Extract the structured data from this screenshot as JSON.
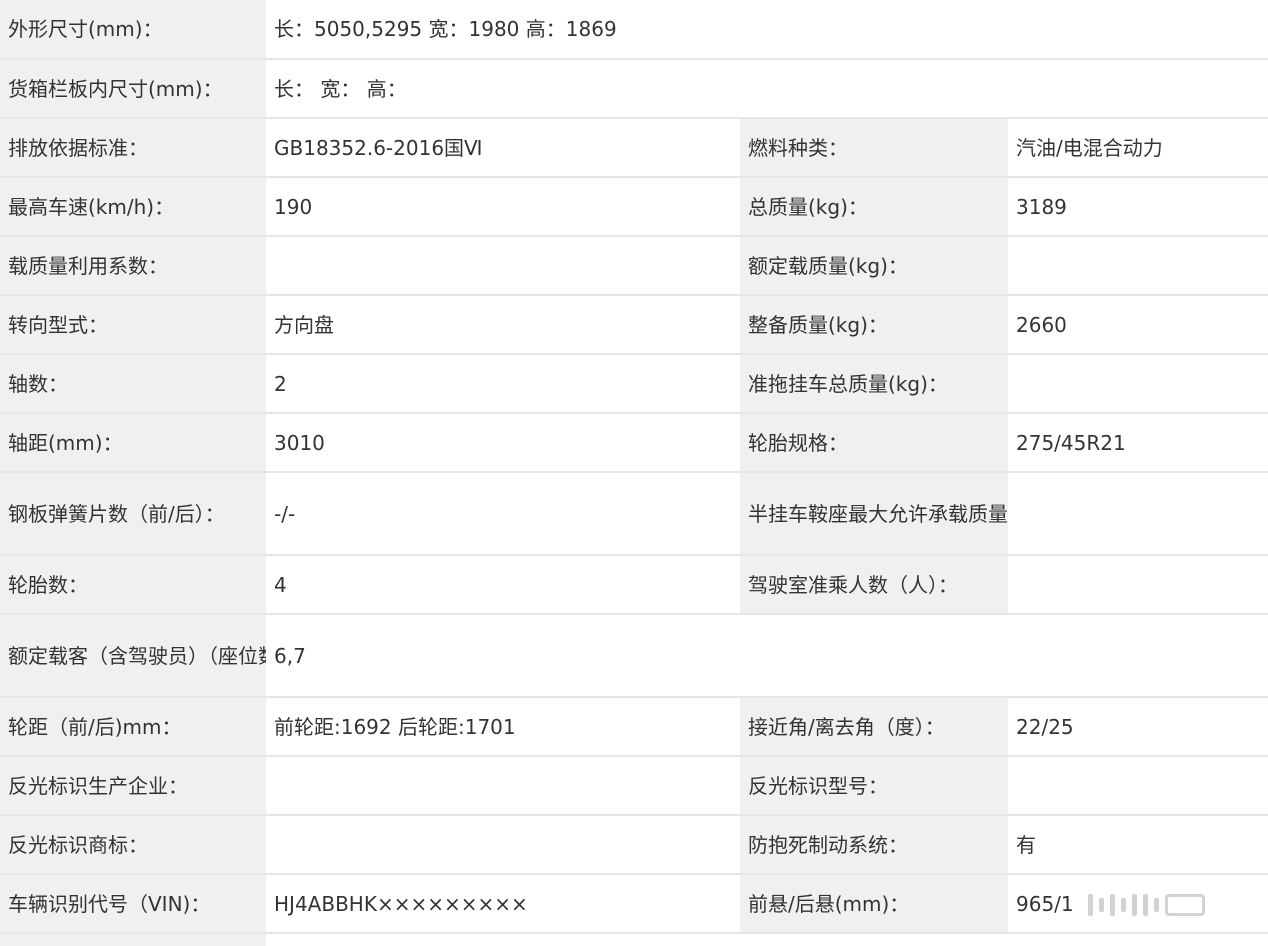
{
  "rows": [
    {
      "l1": "外形尺寸(mm)：",
      "v1": "长：5050,5295 宽：1980 高：1869"
    },
    {
      "l1": "货箱栏板内尺寸(mm)：",
      "v1": "长： 宽： 高："
    },
    {
      "l1": "排放依据标准：",
      "v1": "GB18352.6-2016国Ⅵ",
      "l2": "燃料种类：",
      "v2": "汽油/电混合动力"
    },
    {
      "l1": "最高车速(km/h)：",
      "v1": "190",
      "l2": "总质量(kg)：",
      "v2": "3189"
    },
    {
      "l1": "载质量利用系数：",
      "v1": "",
      "l2": "额定载质量(kg)：",
      "v2": ""
    },
    {
      "l1": "转向型式：",
      "v1": "方向盘",
      "l2": "整备质量(kg)：",
      "v2": "2660"
    },
    {
      "l1": "轴数：",
      "v1": "2",
      "l2": "准拖挂车总质量(kg)：",
      "v2": ""
    },
    {
      "l1": "轴距(mm)：",
      "v1": "3010",
      "l2": "轮胎规格：",
      "v2": "275/45R21"
    },
    {
      "l1": "钢板弹簧片数（前/后）：",
      "v1": "-/-",
      "l2": "半挂车鞍座最大允许承载质量(kg)：",
      "v2": ""
    },
    {
      "l1": "轮胎数：",
      "v1": "4",
      "l2": "驾驶室准乘人数（人）：",
      "v2": ""
    },
    {
      "l1": "额定载客（含驾驶员）（座位数）：",
      "v1": "6,7"
    },
    {
      "l1": "轮距（前/后)mm：",
      "v1": "前轮距:1692 后轮距:1701",
      "l2": "接近角/离去角（度）：",
      "v2": "22/25"
    },
    {
      "l1": "反光标识生产企业：",
      "v1": "",
      "l2": "反光标识型号：",
      "v2": ""
    },
    {
      "l1": "反光标识商标：",
      "v1": "",
      "l2": "防抱死制动系统：",
      "v2": "有"
    },
    {
      "l1": "车辆识别代号（VIN)：",
      "v1": "HJ4ABBHK×××××××××",
      "l2": "前悬/后悬(mm)：",
      "v2": "965/1"
    }
  ]
}
